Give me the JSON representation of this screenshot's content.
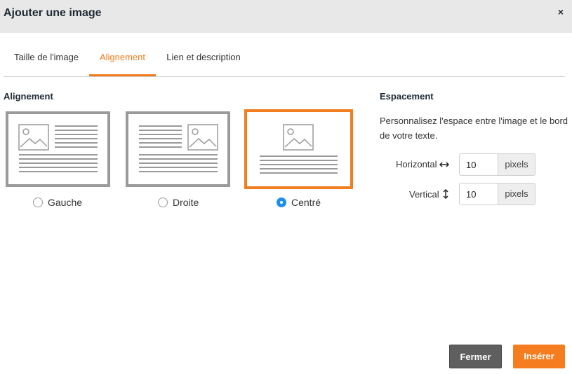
{
  "dialog": {
    "title": "Ajouter une image",
    "close_icon": "×"
  },
  "tabs": [
    {
      "label": "Taille de l'image",
      "active": false
    },
    {
      "label": "Alignement",
      "active": true
    },
    {
      "label": "Lien et description",
      "active": false
    }
  ],
  "alignment": {
    "title": "Alignement",
    "options": [
      {
        "label": "Gauche",
        "checked": false
      },
      {
        "label": "Droite",
        "checked": false
      },
      {
        "label": "Centré",
        "checked": true
      }
    ]
  },
  "spacing": {
    "title": "Espacement",
    "description": "Personnalisez l'espace entre l'image et le bord de votre texte.",
    "horizontal": {
      "label": "Horizontal",
      "value": "10",
      "unit": "pixels"
    },
    "vertical": {
      "label": "Vertical",
      "value": "10",
      "unit": "pixels"
    }
  },
  "buttons": {
    "close": "Fermer",
    "insert": "Insérer"
  },
  "colors": {
    "accent": "#f07d1e",
    "radio": "#1e8df0",
    "border": "#9a9a9a",
    "close_button": "#5f5f5f"
  }
}
